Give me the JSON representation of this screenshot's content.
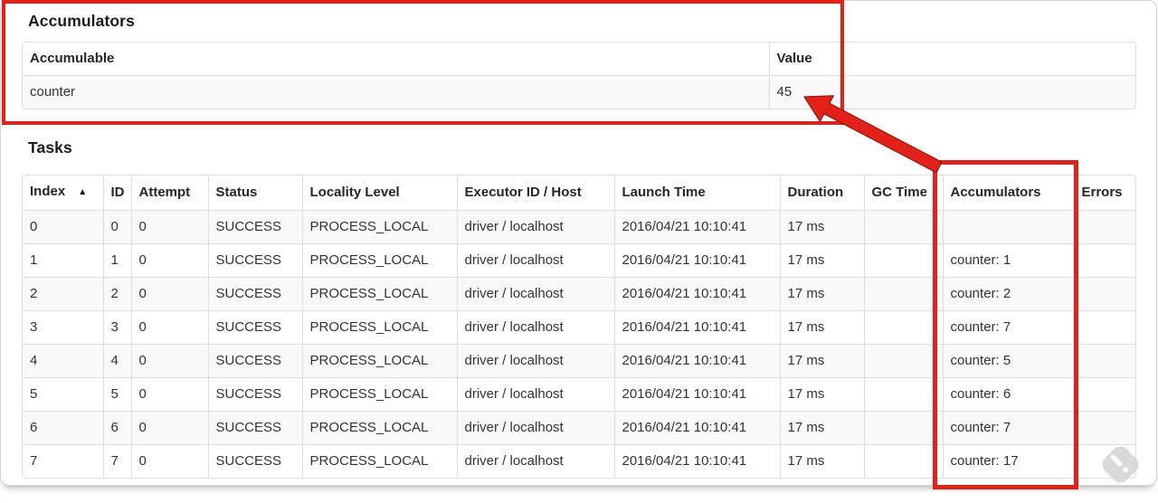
{
  "accumulators_section": {
    "heading": "Accumulators",
    "table": {
      "headers": [
        "Accumulable",
        "Value"
      ],
      "rows": [
        [
          "counter",
          "45"
        ]
      ]
    }
  },
  "tasks_section": {
    "heading": "Tasks",
    "sort_icon": "▲",
    "table": {
      "headers": [
        "Index",
        "ID",
        "Attempt",
        "Status",
        "Locality Level",
        "Executor ID / Host",
        "Launch Time",
        "Duration",
        "GC Time",
        "Accumulators",
        "Errors"
      ],
      "rows": [
        [
          "0",
          "0",
          "0",
          "SUCCESS",
          "PROCESS_LOCAL",
          "driver / localhost",
          "2016/04/21 10:10:41",
          "17 ms",
          "",
          "",
          ""
        ],
        [
          "1",
          "1",
          "0",
          "SUCCESS",
          "PROCESS_LOCAL",
          "driver / localhost",
          "2016/04/21 10:10:41",
          "17 ms",
          "",
          "counter: 1",
          ""
        ],
        [
          "2",
          "2",
          "0",
          "SUCCESS",
          "PROCESS_LOCAL",
          "driver / localhost",
          "2016/04/21 10:10:41",
          "17 ms",
          "",
          "counter: 2",
          ""
        ],
        [
          "3",
          "3",
          "0",
          "SUCCESS",
          "PROCESS_LOCAL",
          "driver / localhost",
          "2016/04/21 10:10:41",
          "17 ms",
          "",
          "counter: 7",
          ""
        ],
        [
          "4",
          "4",
          "0",
          "SUCCESS",
          "PROCESS_LOCAL",
          "driver / localhost",
          "2016/04/21 10:10:41",
          "17 ms",
          "",
          "counter: 5",
          ""
        ],
        [
          "5",
          "5",
          "0",
          "SUCCESS",
          "PROCESS_LOCAL",
          "driver / localhost",
          "2016/04/21 10:10:41",
          "17 ms",
          "",
          "counter: 6",
          ""
        ],
        [
          "6",
          "6",
          "0",
          "SUCCESS",
          "PROCESS_LOCAL",
          "driver / localhost",
          "2016/04/21 10:10:41",
          "17 ms",
          "",
          "counter: 7",
          ""
        ],
        [
          "7",
          "7",
          "0",
          "SUCCESS",
          "PROCESS_LOCAL",
          "driver / localhost",
          "2016/04/21 10:10:41",
          "17 ms",
          "",
          "counter: 17",
          ""
        ]
      ]
    }
  },
  "annotations": {
    "accent_color": "#e32119",
    "accent_edge_color": "#9d120b",
    "highlighted_value": "45",
    "highlighted_column": "Accumulators"
  },
  "watermark": {
    "icon": "feedly-logo-icon",
    "color": "#d3d3d3"
  }
}
